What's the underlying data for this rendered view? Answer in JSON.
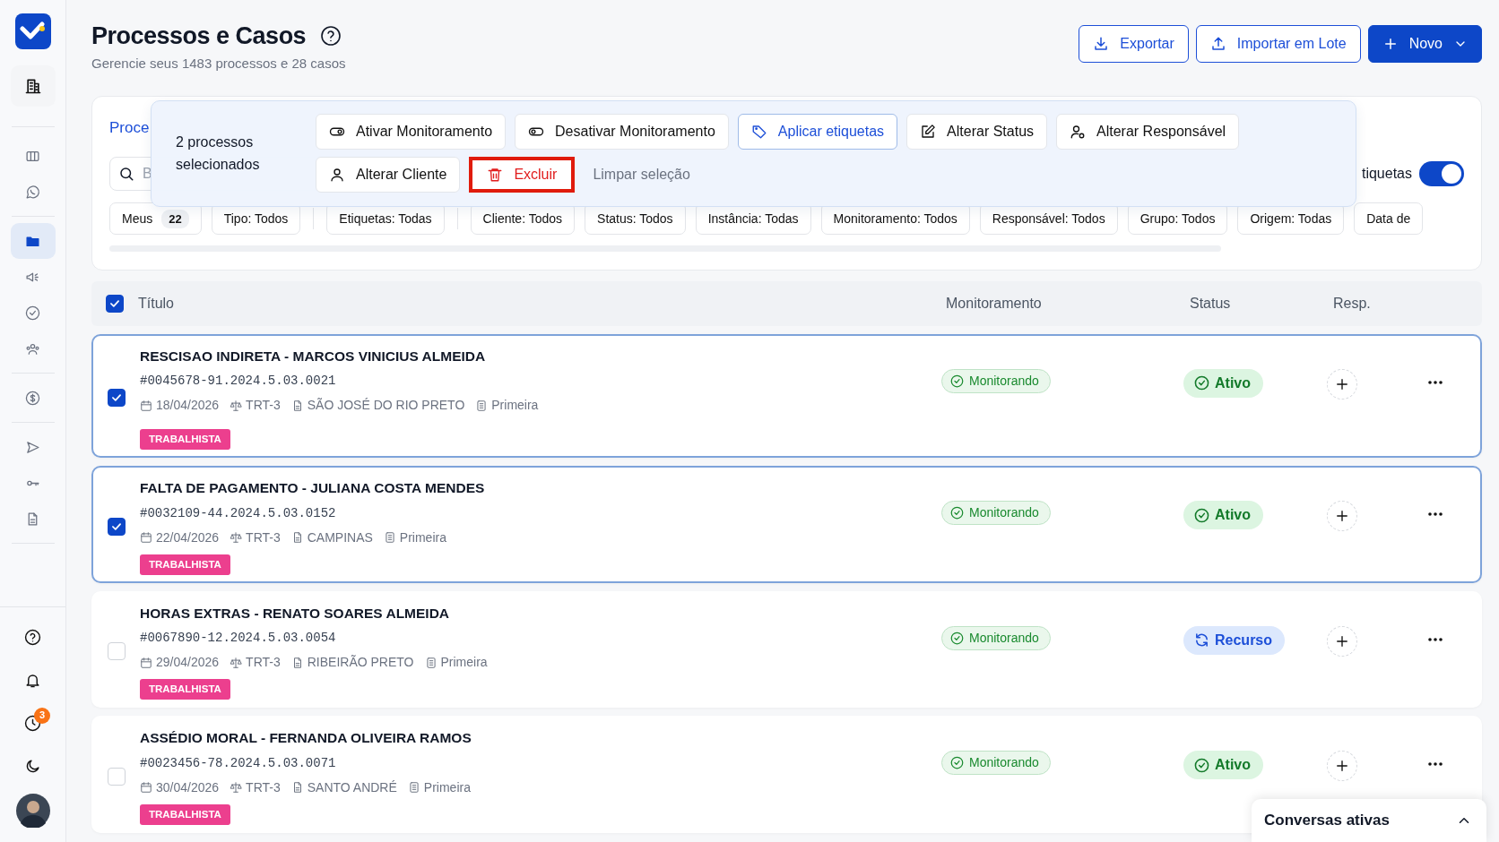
{
  "sidebar": {
    "items": [
      {
        "selected": false
      },
      {
        "selected": false
      },
      {
        "selected": false
      },
      {
        "selected": true
      },
      {
        "selected": false
      },
      {
        "selected": false
      },
      {
        "selected": false
      },
      {
        "selected": false
      },
      {
        "selected": false
      },
      {
        "selected": false
      },
      {
        "selected": false
      }
    ],
    "notification_badge": "3"
  },
  "header": {
    "title": "Processos e Casos",
    "subtitle": "Gerencie seus 1483 processos e 28 casos"
  },
  "actions": [
    {
      "label": "Exportar",
      "kind": "export"
    },
    {
      "label": "Importar em Lote",
      "kind": "import"
    },
    {
      "label": "Novo",
      "kind": "new"
    }
  ],
  "filters": {
    "tab": {
      "label": "Proce",
      "selected": true
    },
    "search_placeholder": "B",
    "chips": [
      {
        "label": "Meus",
        "count": "22"
      },
      {
        "label": "Tipo: Todos"
      },
      {
        "label": "Etiquetas: Todas"
      },
      {
        "label": "Cliente: Todos"
      },
      {
        "label": "Status: Todos"
      },
      {
        "label": "Instância: Todas"
      },
      {
        "label": "Monitoramento: Todos"
      },
      {
        "label": "Responsável: Todos"
      },
      {
        "label": "Grupo: Todos"
      },
      {
        "label": "Origem: Todas"
      },
      {
        "label": "Data de"
      }
    ],
    "tags_toggle": {
      "label": "tiquetas",
      "on": true
    }
  },
  "bulk_bar": {
    "count_text": "2 processos selecionados",
    "actions": [
      {
        "label": "Ativar Monitoramento",
        "kind": "monitor-on"
      },
      {
        "label": "Desativar Monitoramento",
        "kind": "monitor-off"
      },
      {
        "label": "Aplicar etiquetas",
        "kind": "tags"
      },
      {
        "label": "Alterar Status",
        "kind": "status"
      },
      {
        "label": "Alterar Responsável",
        "kind": "owner"
      },
      {
        "label": "Alterar Cliente",
        "kind": "client"
      },
      {
        "label": "Excluir",
        "kind": "delete"
      }
    ],
    "clear": "Limpar seleção"
  },
  "table": {
    "select_all": true,
    "columns": [
      "Título",
      "Monitoramento",
      "Status",
      "Resp."
    ],
    "rows": [
      {
        "selected": true,
        "title": "RESCISAO INDIRETA - MARCOS VINICIUS ALMEIDA",
        "number": "#0045678-91.2024.5.03.0021",
        "date": "18/04/2026",
        "court": "TRT-3",
        "city": "SÃO JOSÉ DO RIO PRETO",
        "instance": "Primeira",
        "tag": "TRABALHISTA",
        "monitoring": "Monitorando",
        "status": {
          "label": "Ativo",
          "kind": "active"
        }
      },
      {
        "selected": true,
        "title": "FALTA DE PAGAMENTO - JULIANA COSTA MENDES",
        "number": "#0032109-44.2024.5.03.0152",
        "date": "22/04/2026",
        "court": "TRT-3",
        "city": "CAMPINAS",
        "instance": "Primeira",
        "tag": "TRABALHISTA",
        "monitoring": "Monitorando",
        "status": {
          "label": "Ativo",
          "kind": "active"
        }
      },
      {
        "selected": false,
        "title": "HORAS EXTRAS - RENATO SOARES ALMEIDA",
        "number": "#0067890-12.2024.5.03.0054",
        "date": "29/04/2026",
        "court": "TRT-3",
        "city": "RIBEIRÃO PRETO",
        "instance": "Primeira",
        "tag": "TRABALHISTA",
        "monitoring": "Monitorando",
        "status": {
          "label": "Recurso",
          "kind": "appeal"
        }
      },
      {
        "selected": false,
        "title": "ASSÉDIO MORAL - FERNANDA OLIVEIRA RAMOS",
        "number": "#0023456-78.2024.5.03.0071",
        "date": "30/04/2026",
        "court": "TRT-3",
        "city": "SANTO ANDRÉ",
        "instance": "Primeira",
        "tag": "TRABALHISTA",
        "monitoring": "Monitorando",
        "status": {
          "label": "Ativo",
          "kind": "active"
        }
      }
    ]
  },
  "chat_panel": {
    "title": "Conversas ativas"
  }
}
